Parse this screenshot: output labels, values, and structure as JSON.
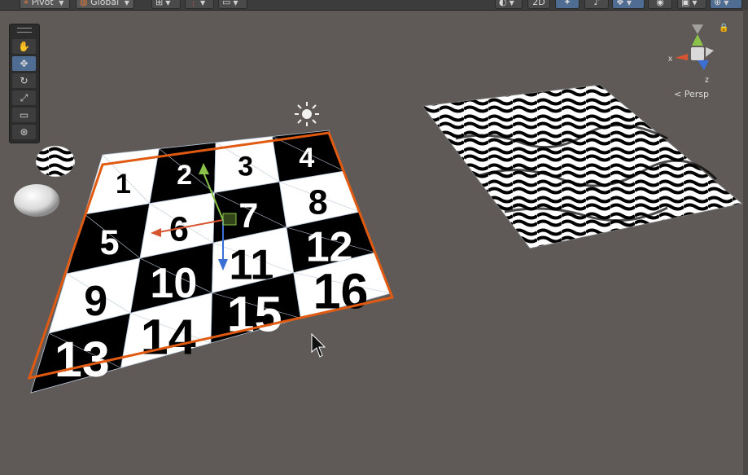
{
  "toolbar": {
    "pivot_label": "Pivot",
    "global_label": "Global",
    "mode_2d_label": "2D"
  },
  "gizmo": {
    "projection_label": "Persp",
    "x_axis": "x",
    "z_axis": "z",
    "colors": {
      "x": "#d6542f",
      "y": "#8bc34a",
      "z": "#3b6fd4"
    }
  },
  "scene_tools": {
    "items": [
      "hand-tool",
      "move-tool",
      "rotate-tool",
      "scale-tool",
      "rect-tool",
      "transform-tool"
    ],
    "active": "move-tool"
  },
  "plane_left": {
    "numbers": [
      "1",
      "2",
      "3",
      "4",
      "5",
      "6",
      "7",
      "8",
      "9",
      "10",
      "11",
      "12",
      "13",
      "14",
      "15",
      "16"
    ],
    "selection_color": "#e05a12"
  }
}
